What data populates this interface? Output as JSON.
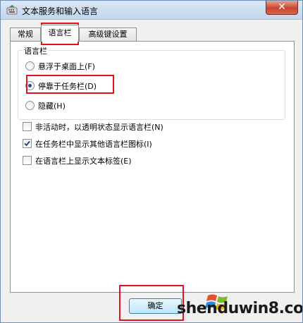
{
  "window": {
    "title": "文本服务和输入语言",
    "close_label": "✕"
  },
  "tabs": [
    {
      "label": "常规",
      "active": false
    },
    {
      "label": "语言栏",
      "active": true
    },
    {
      "label": "高级键设置",
      "active": false
    }
  ],
  "language_bar_group": {
    "legend": "语言栏",
    "options": [
      {
        "label": "悬浮于桌面上(F)",
        "selected": false
      },
      {
        "label": "停靠于任务栏(D)",
        "selected": true
      },
      {
        "label": "隐藏(H)",
        "selected": false
      }
    ]
  },
  "checkboxes": [
    {
      "label": "非活动时，以透明状态显示语言栏(N)",
      "checked": false
    },
    {
      "label": "在任务栏中显示其他语言栏图标(I)",
      "checked": true
    },
    {
      "label": "在语言栏上显示文本标签(E)",
      "checked": false
    }
  ],
  "buttons": {
    "ok_label": "确定"
  },
  "watermark": {
    "text": "shenduwin8.com"
  },
  "colors": {
    "highlight": "#e0141e",
    "title_bar": "#c2d6ee",
    "close": "#c8452f"
  }
}
